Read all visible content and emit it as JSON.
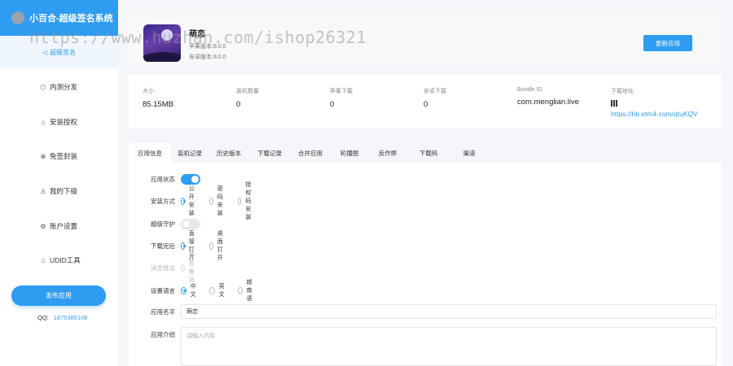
{
  "brand": {
    "title": "小百合-超级签名系统"
  },
  "sidebar": {
    "sub_item": "超级签名",
    "items": [
      {
        "icon": "box-icon",
        "glyph": "⬡",
        "label": "内测分发"
      },
      {
        "icon": "tag-icon",
        "glyph": "⌂",
        "label": "安装授权"
      },
      {
        "icon": "globe-icon",
        "glyph": "⊕",
        "label": "免签封装"
      },
      {
        "icon": "user-icon",
        "glyph": "♙",
        "label": "我的下级"
      },
      {
        "icon": "gear-icon",
        "glyph": "⚙",
        "label": "账户设置"
      },
      {
        "icon": "tag-icon",
        "glyph": "⌂",
        "label": "UDID工具"
      }
    ],
    "publish_label": "发布应用",
    "qq_label": "QQ:",
    "qq_number": "1875385108"
  },
  "app": {
    "name": "萌恋",
    "apple_version": "苹果版本:8.0.0",
    "android_version": "安卓版本:8.0.0",
    "update_label": "更新应用"
  },
  "stats": [
    {
      "label": "大小",
      "value": "85.15MB"
    },
    {
      "label": "装机数量",
      "value": "0"
    },
    {
      "label": "苹果下载",
      "value": "0"
    },
    {
      "label": "安卓下载",
      "value": "0"
    },
    {
      "label": "Bundle ID",
      "value": "com.menglian.live"
    },
    {
      "label": "下载地址",
      "value": "https://hb.etm4.com/qtuKQV"
    }
  ],
  "tabs": [
    "应用信息",
    "装机记录",
    "历史版本",
    "下载记录",
    "合并应用",
    "轮播图",
    "反作弊",
    "下载码",
    "渠道"
  ],
  "form": {
    "status_label": "应用状态",
    "install_label": "安装方式",
    "install_options": [
      "公开安装",
      "密码安装",
      "授权码安装"
    ],
    "guard_label": "超级守护",
    "after_label": "下载完后",
    "after_options": [
      "直接打开",
      "桌面打开"
    ],
    "push_label": "消息推送",
    "push_option": "重签推送",
    "lang_label": "设置语言",
    "lang_options": [
      "中文",
      "英文",
      "越南语"
    ],
    "name_label": "应用名字",
    "name_value": "萌恋",
    "intro_label": "应用介绍",
    "intro_placeholder": "请输入内容"
  },
  "watermark": "https://www.huzhan.com/ishop26321"
}
